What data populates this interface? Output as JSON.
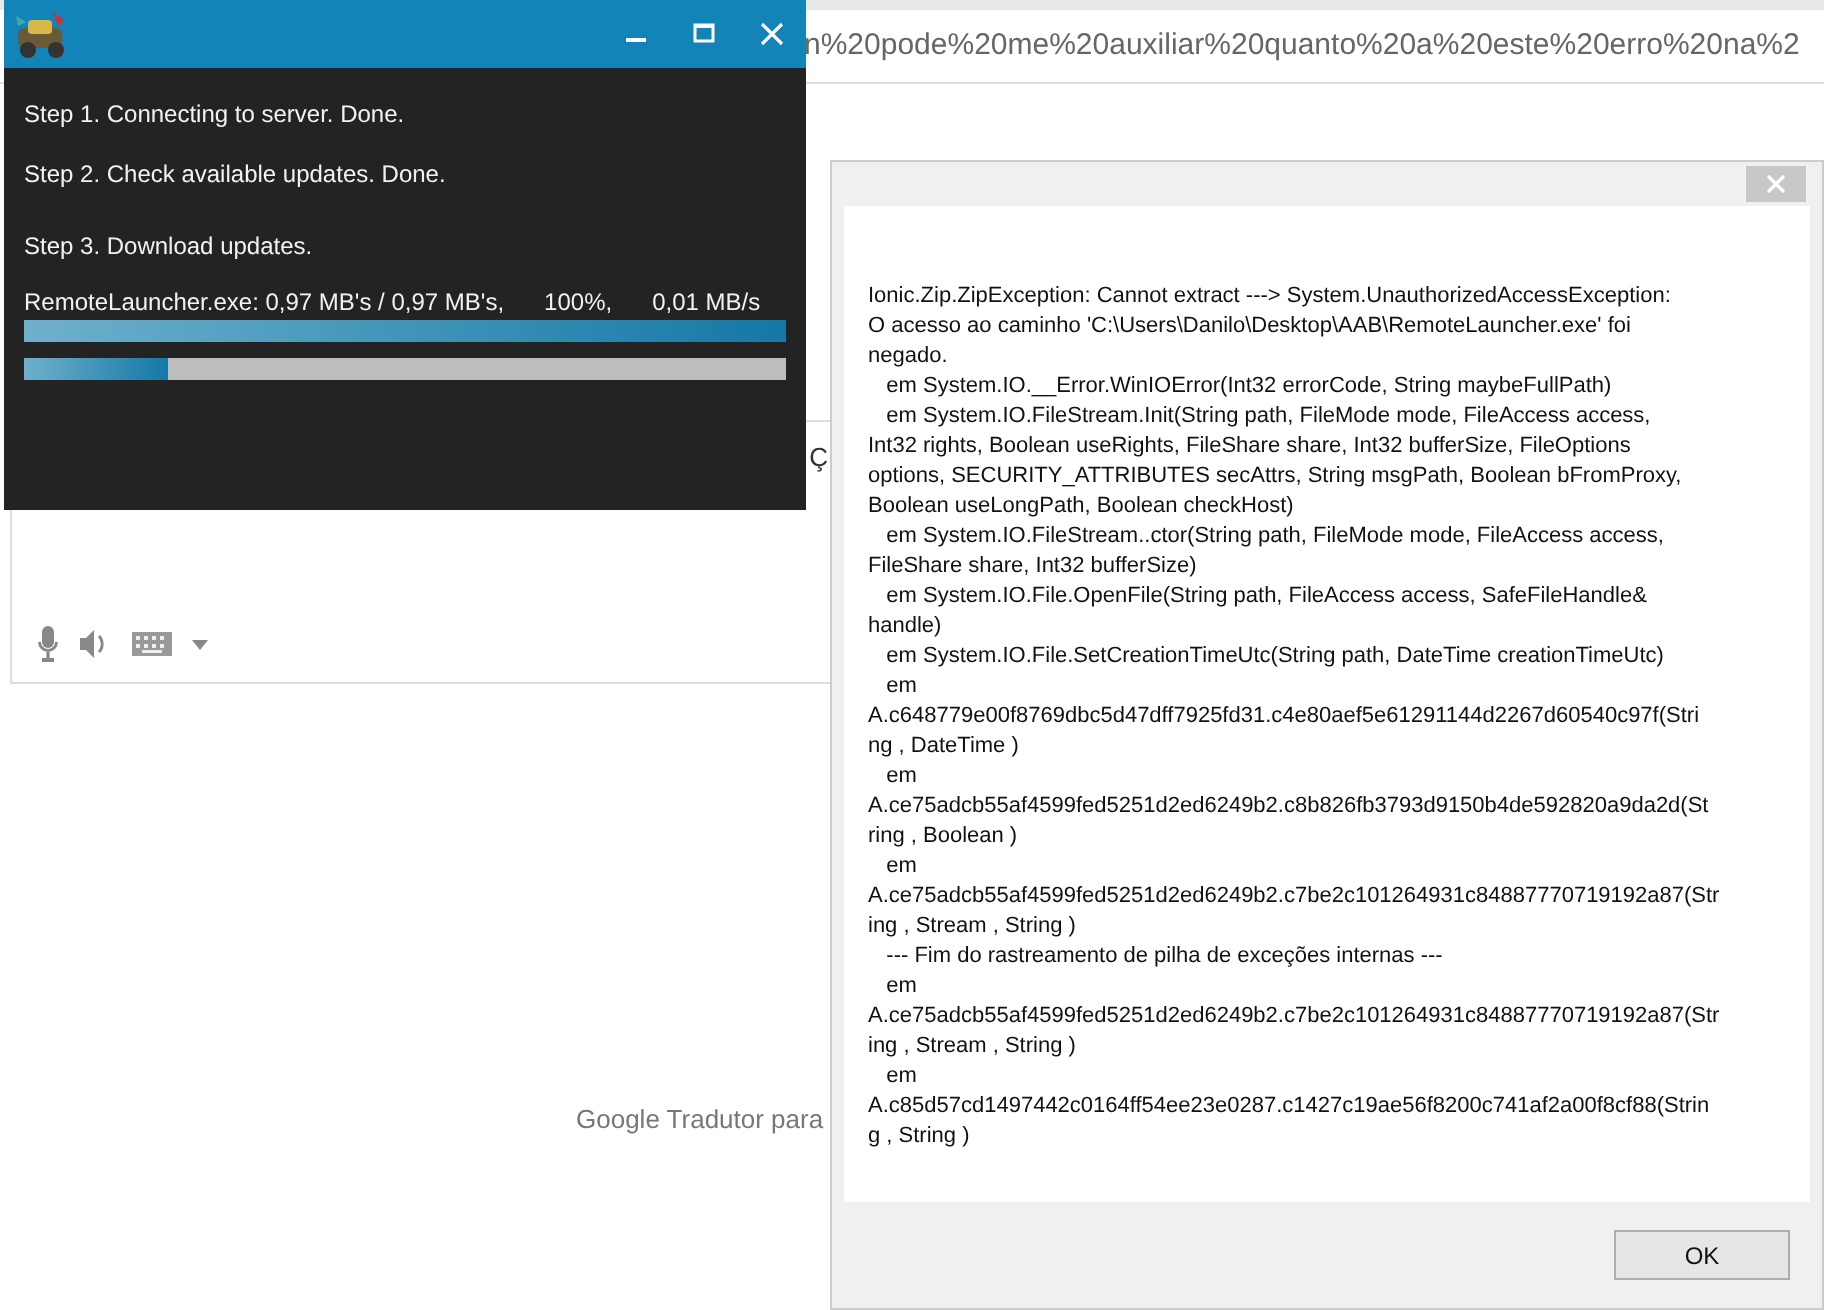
{
  "browser": {
    "address": "n%20pode%20me%20auxiliar%20quanto%20a%20este%20erro%20na%2",
    "panel_text": "Ç",
    "footer_text": "Google Tradutor para"
  },
  "launcher": {
    "steps": [
      "Step 1. Connecting to server. Done.",
      "Step 2. Check available updates. Done.",
      "Step 3. Download updates."
    ],
    "file_status": [
      "RemoteLauncher.exe: 0,97 MB's / 0,97 MB's,",
      "100%,",
      "0,01 MB/s"
    ],
    "progress": [
      {
        "level": 1
      },
      {
        "level": 0.19
      }
    ]
  },
  "error_dialog": {
    "message_lines": [
      "Ionic.Zip.ZipException: Cannot extract ---> System.UnauthorizedAccessException:",
      "O acesso ao caminho 'C:\\Users\\Danilo\\Desktop\\AAB\\RemoteLauncher.exe' foi",
      "negado.",
      "   em System.IO.__Error.WinIOError(Int32 errorCode, String maybeFullPath)",
      "   em System.IO.FileStream.Init(String path, FileMode mode, FileAccess access,",
      "Int32 rights, Boolean useRights, FileShare share, Int32 bufferSize, FileOptions",
      "options, SECURITY_ATTRIBUTES secAttrs, String msgPath, Boolean bFromProxy,",
      "Boolean useLongPath, Boolean checkHost)",
      "   em System.IO.FileStream..ctor(String path, FileMode mode, FileAccess access,",
      "FileShare share, Int32 bufferSize)",
      "   em System.IO.File.OpenFile(String path, FileAccess access, SafeFileHandle&",
      "handle)",
      "   em System.IO.File.SetCreationTimeUtc(String path, DateTime creationTimeUtc)",
      "   em",
      "A.c648779e00f8769dbc5d47dff7925fd31.c4e80aef5e61291144d2267d60540c97f(Stri",
      "ng , DateTime )",
      "   em",
      "A.ce75adcb55af4599fed5251d2ed6249b2.c8b826fb3793d9150b4de592820a9da2d(St",
      "ring , Boolean )",
      "   em",
      "A.ce75adcb55af4599fed5251d2ed6249b2.c7be2c101264931c84887770719192a87(Str",
      "ing , Stream , String )",
      "   --- Fim do rastreamento de pilha de exceções internas ---",
      "   em",
      "A.ce75adcb55af4599fed5251d2ed6249b2.c7be2c101264931c84887770719192a87(Str",
      "ing , Stream , String )",
      "   em",
      "A.c85d57cd1497442c0164ff54ee23e0287.c1427c19ae56f8200c741af2a00f8cf88(Strin",
      "g , String )"
    ],
    "button": "OK"
  }
}
